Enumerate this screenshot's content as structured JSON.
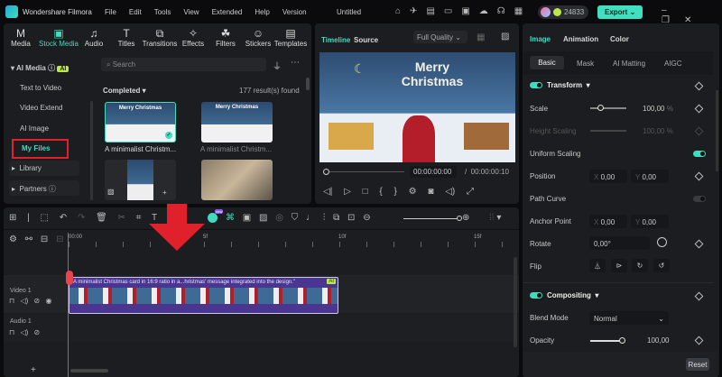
{
  "app": {
    "name": "Wondershare Filmora",
    "project": "Untitled",
    "credits": "24833",
    "export": "Export"
  },
  "menu": [
    "File",
    "Edit",
    "Tools",
    "View",
    "Extended",
    "Help",
    "Version"
  ],
  "toolbar_tabs": [
    {
      "label": "Media",
      "icon": "M"
    },
    {
      "label": "Stock Media",
      "icon": "▣"
    },
    {
      "label": "Audio",
      "icon": "♫"
    },
    {
      "label": "Titles",
      "icon": "T"
    },
    {
      "label": "Transitions",
      "icon": "⧉"
    },
    {
      "label": "Effects",
      "icon": "✧"
    },
    {
      "label": "Filters",
      "icon": "☘"
    },
    {
      "label": "Stickers",
      "icon": "☺"
    },
    {
      "label": "Templates",
      "icon": "▤"
    }
  ],
  "sidebar": {
    "ai_media": "AI Media",
    "ai_badge": "AI",
    "items": [
      "Text to Video",
      "Video Extend",
      "AI Image",
      "My Files"
    ],
    "library": "Library",
    "partners": "Partners"
  },
  "content": {
    "search_placeholder": "Search",
    "filter": "Completed",
    "results": "177 result(s) found",
    "thumb_text": "Merry Christmas",
    "items": [
      "A minimalist Christm...",
      "A minimalist Christm..."
    ]
  },
  "preview": {
    "tab_timeline": "Timeline",
    "tab_source": "Source",
    "quality": "Full Quality",
    "title_text": "Merry Christmas",
    "current_time": "00:00:00:00",
    "total_time": "00:00:00:10"
  },
  "right": {
    "tabs": [
      "Image",
      "Animation",
      "Color"
    ],
    "subtabs": [
      "Basic",
      "Mask",
      "AI Matting",
      "AIGC"
    ],
    "transform": "Transform",
    "scale": {
      "label": "Scale",
      "value": "100,00",
      "unit": "%",
      "fraction": 0.25
    },
    "height_scaling": {
      "label": "Height Scaling",
      "value": "100,00",
      "unit": "%"
    },
    "uniform": "Uniform Scaling",
    "position": {
      "label": "Position",
      "x": "0,00",
      "y": "0,00"
    },
    "path_curve": "Path Curve",
    "anchor": {
      "label": "Anchor Point",
      "x": "0,00",
      "y": "0,00"
    },
    "rotate": {
      "label": "Rotate",
      "value": "0,00°"
    },
    "flip": "Flip",
    "compositing": "Compositing",
    "blend": {
      "label": "Blend Mode",
      "value": "Normal"
    },
    "opacity": {
      "label": "Opacity",
      "value": "100,00",
      "fraction": 1.0
    },
    "reset": "Reset",
    "x_label": "X",
    "y_label": "Y"
  },
  "timeline": {
    "ruler": [
      "00:00",
      "5f",
      "10f",
      "15f"
    ],
    "track_video": "Video 1",
    "track_audio": "Audio 1",
    "clip_title": "A minimalist Christmas card in 16:9 ratio in a...hristmas' message integrated into the design.\"",
    "clip_badge": "AI",
    "new_badge": "new"
  },
  "colors": {
    "accent": "#3fdcc0",
    "highlight_red": "#e0202a",
    "clip": "#5b3f9e"
  }
}
